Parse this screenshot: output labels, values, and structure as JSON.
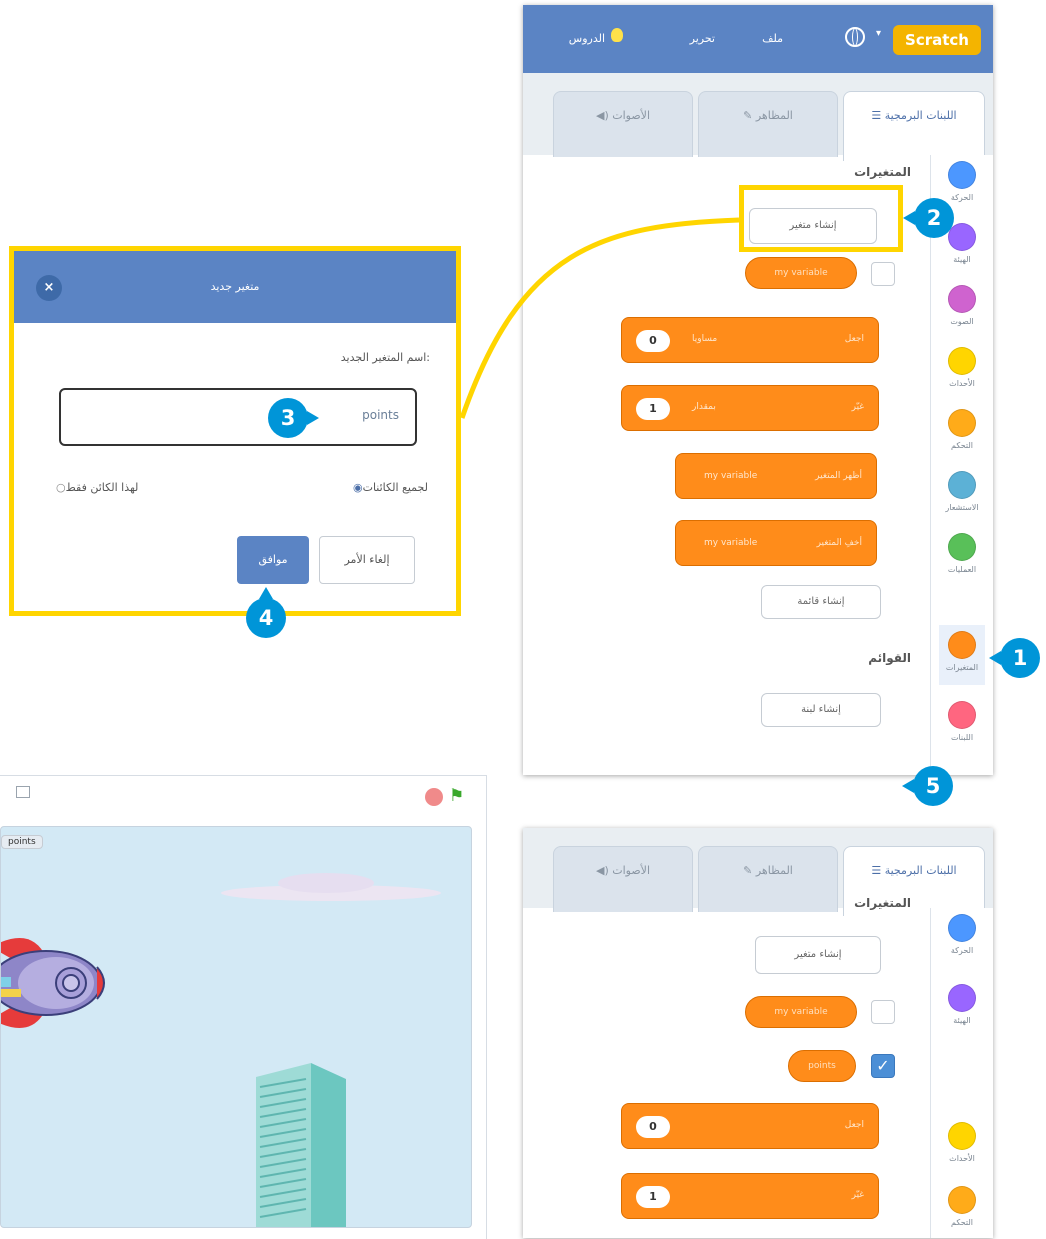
{
  "editor": {
    "menu": {
      "logo": "Scratch",
      "file": "ملف",
      "edit": "تحرير",
      "tutorials": "الدروس"
    },
    "tabs": {
      "code": "اللبنات البرمجية",
      "costumes": "المظاهر",
      "sounds": "الأصوات"
    },
    "categories": [
      {
        "label": "الحركة",
        "color": "#4c97ff"
      },
      {
        "label": "الهيئة",
        "color": "#9966ff"
      },
      {
        "label": "الصوت",
        "color": "#cf63cf"
      },
      {
        "label": "الأحداث",
        "color": "#ffd500"
      },
      {
        "label": "التحكم",
        "color": "#ffab19"
      },
      {
        "label": "الاستشعار",
        "color": "#5cb1d6"
      },
      {
        "label": "العمليات",
        "color": "#59c059"
      },
      {
        "label": "المتغيرات",
        "color": "#ff8c1a"
      },
      {
        "label": "اللبنات",
        "color": "#ff6680"
      }
    ],
    "variables_heading": "المتغيرات",
    "make_variable": "إنشاء متغير",
    "my_variable": "my variable",
    "block_set": {
      "verb": "اجعل",
      "value": "0",
      "middle": "مساويا"
    },
    "block_change": {
      "verb": "غيّر",
      "value": "1",
      "middle": "بمقدار"
    },
    "block_show": "أظهر المتغير",
    "block_hide": "أخفِ المتغير",
    "make_list": "إنشاء قائمة",
    "lists_heading": "القوائم",
    "make_block": "إنشاء لبنة"
  },
  "dialog": {
    "title": "متغير جديد",
    "close": "×",
    "field_label": "اسم المتغير الجديد:",
    "input_value": "points",
    "option_all": "لجميع الكائنات",
    "option_this": "لهذا الكائن فقط",
    "ok": "موافق",
    "cancel": "إلغاء الأمر"
  },
  "stage": {
    "monitor_label": "points"
  },
  "editor2": {
    "tabs": {
      "code": "اللبنات البرمجية",
      "costumes": "المظاهر",
      "sounds": "الأصوات"
    },
    "categories": [
      {
        "label": "الحركة",
        "color": "#4c97ff"
      },
      {
        "label": "الهيئة",
        "color": "#9966ff"
      },
      {
        "label": "الأحداث",
        "color": "#ffd500"
      },
      {
        "label": "التحكم",
        "color": "#ffab19"
      }
    ],
    "variables_heading": "المتغيرات",
    "make_variable": "إنشاء متغير",
    "my_variable": "my variable",
    "points_var": "points",
    "block_set_value": "0",
    "block_change_value": "1",
    "block_set_verb": "اجعل",
    "block_change_verb": "غيّر"
  },
  "steps": [
    "1",
    "2",
    "3",
    "4",
    "5"
  ],
  "highlight_color": "#ffd500",
  "badge_color": "#0095d8"
}
